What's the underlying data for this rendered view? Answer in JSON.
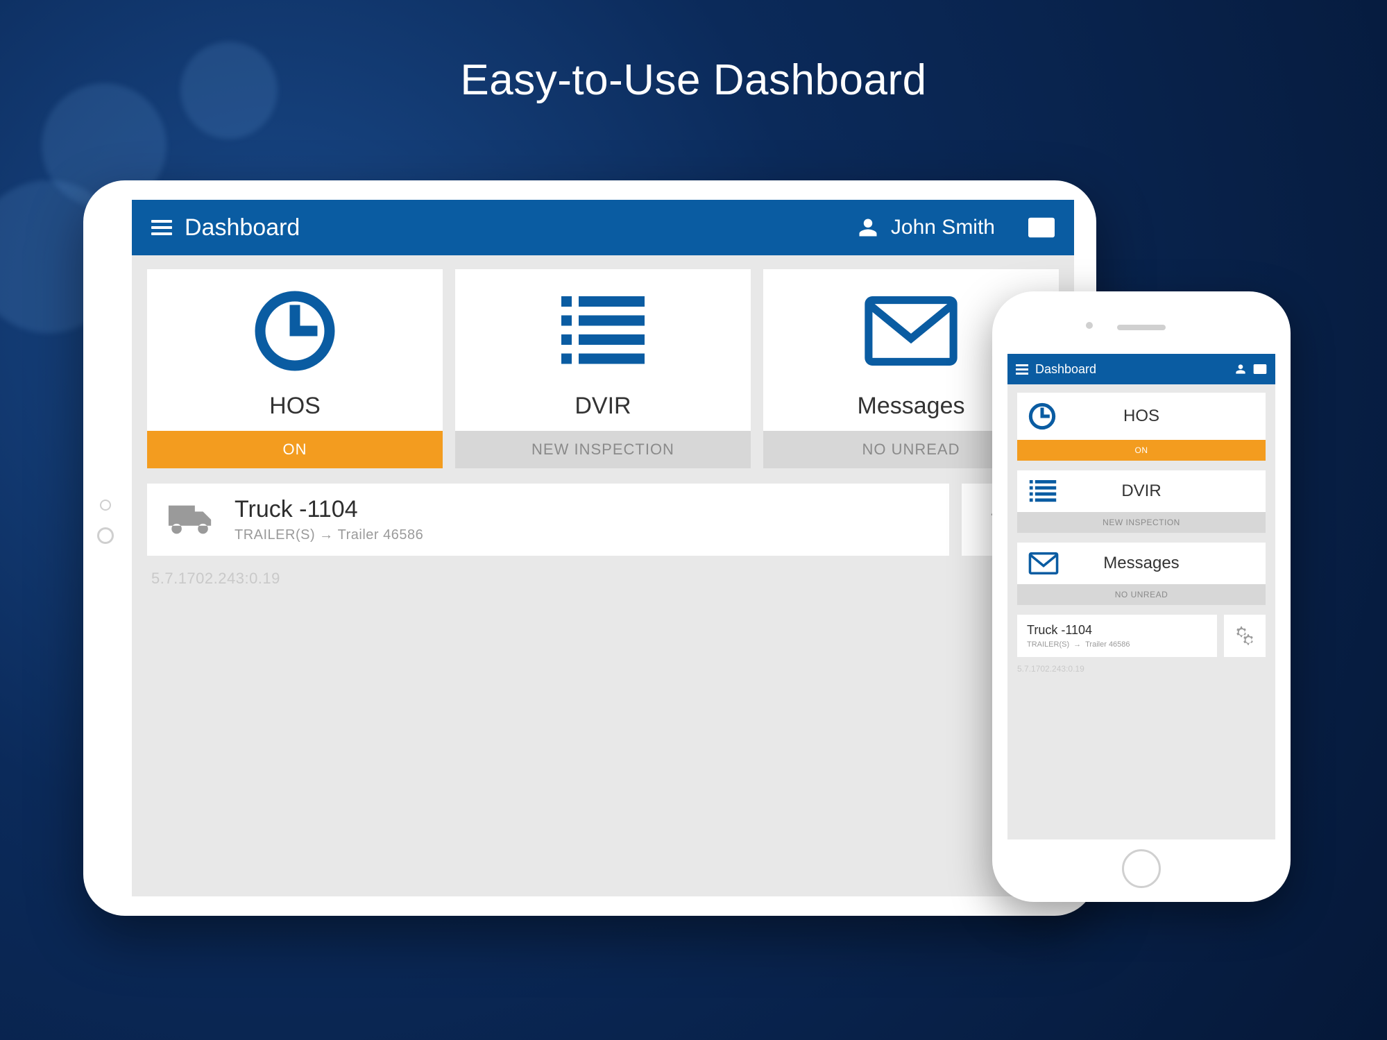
{
  "headline": "Easy-to-Use Dashboard",
  "tablet": {
    "header": {
      "title": "Dashboard",
      "user_name": "John Smith"
    },
    "tiles": [
      {
        "label": "HOS",
        "status": "ON",
        "status_style": "on"
      },
      {
        "label": "DVIR",
        "status": "NEW INSPECTION",
        "status_style": "grey"
      },
      {
        "label": "Messages",
        "status": "NO UNREAD",
        "status_style": "grey"
      }
    ],
    "vehicle": {
      "name": "Truck -1104",
      "trailer_prefix": "TRAILER(S)",
      "trailer_value": "Trailer 46586"
    },
    "version": "5.7.1702.243:0.19"
  },
  "phone": {
    "header": {
      "title": "Dashboard"
    },
    "tiles": [
      {
        "label": "HOS",
        "status": "ON",
        "status_style": "on"
      },
      {
        "label": "DVIR",
        "status": "NEW INSPECTION",
        "status_style": "grey"
      },
      {
        "label": "Messages",
        "status": "NO UNREAD",
        "status_style": "grey"
      }
    ],
    "vehicle": {
      "name": "Truck -1104",
      "trailer_prefix": "TRAILER(S)",
      "trailer_value": "Trailer 46586"
    },
    "version": "5.7.1702.243:0.19"
  },
  "colors": {
    "brand": "#0a5ca2",
    "accent": "#f39c1f"
  }
}
